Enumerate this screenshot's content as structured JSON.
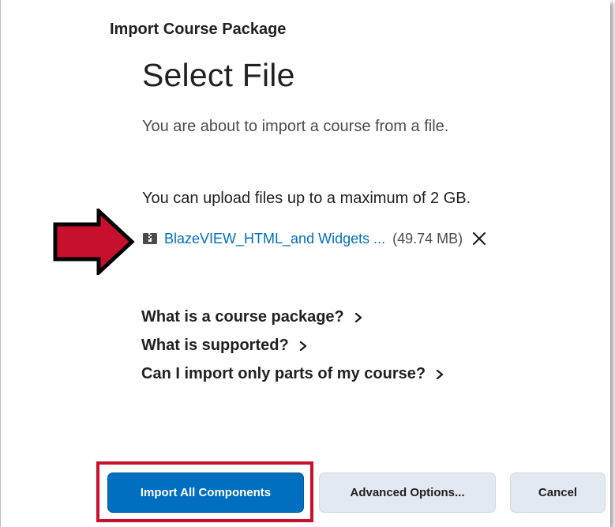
{
  "breadcrumb": "Import Course Package",
  "page_title": "Select File",
  "intro_text": "You are about to import a course from a file.",
  "upload_limit_text": "You can upload files up to a maximum of 2 GB.",
  "file": {
    "name": "BlazeVIEW_HTML_and Widgets ...",
    "size": "(49.74 MB)",
    "icon": "file-archive-icon",
    "remove_icon": "close-icon"
  },
  "help_links": [
    {
      "label": "What is a course package?",
      "icon": "chevron-right-icon"
    },
    {
      "label": "What is supported?",
      "icon": "chevron-right-icon"
    },
    {
      "label": "Can I import only parts of my course?",
      "icon": "chevron-right-icon"
    }
  ],
  "buttons": {
    "import_all": "Import All Components",
    "advanced": "Advanced Options...",
    "cancel": "Cancel"
  },
  "colors": {
    "primary": "#006fbf",
    "link": "#006fbf",
    "annotation_red": "#c8102e",
    "secondary_button": "#e3e9f1"
  }
}
